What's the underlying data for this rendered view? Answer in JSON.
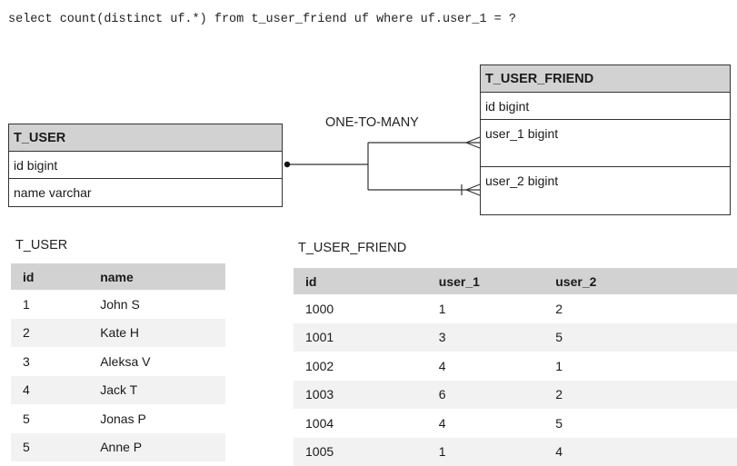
{
  "query": "select count(distinct uf.*) from t_user_friend uf where uf.user_1 = ?",
  "diagram": {
    "user_entity": {
      "title": "T_USER",
      "fields": [
        "id bigint",
        "name varchar"
      ]
    },
    "friend_entity": {
      "title": "T_USER_FRIEND",
      "fields": [
        "id bigint",
        "user_1 bigint",
        "user_2 bigint"
      ]
    },
    "relationship_label": "ONE-TO-MANY"
  },
  "users_table": {
    "caption": "T_USER",
    "headers": [
      "id",
      "name"
    ],
    "rows": [
      [
        "1",
        "John S"
      ],
      [
        "2",
        "Kate H"
      ],
      [
        "3",
        "Aleksa V"
      ],
      [
        "4",
        "Jack T"
      ],
      [
        "5",
        "Jonas P"
      ],
      [
        "5",
        "Anne P"
      ]
    ]
  },
  "friends_table": {
    "caption": "T_USER_FRIEND",
    "headers": [
      "id",
      "user_1",
      "user_2"
    ],
    "rows": [
      [
        "1000",
        "1",
        "2"
      ],
      [
        "1001",
        "3",
        "5"
      ],
      [
        "1002",
        "4",
        "1"
      ],
      [
        "1003",
        "6",
        "2"
      ],
      [
        "1004",
        "4",
        "5"
      ],
      [
        "1005",
        "1",
        "4"
      ]
    ]
  },
  "colors": {
    "header_fill": "#d2d2d2",
    "stripe_fill": "#f2f2f2",
    "line": "#333333"
  }
}
